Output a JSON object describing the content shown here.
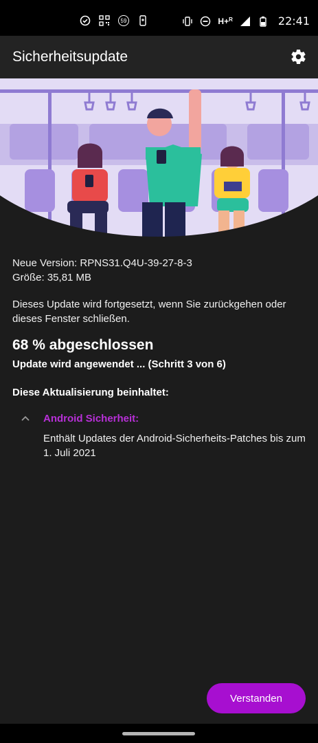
{
  "status_bar": {
    "time": "22:41",
    "notification_badge": "59",
    "network_label": "H+",
    "roaming_label": "R",
    "left_icons": [
      "check-circle-icon",
      "qr-code-icon",
      "badge-59-icon",
      "phone-transfer-icon"
    ],
    "right_icons": [
      "vibrate-icon",
      "do-not-disturb-icon",
      "signal-icon",
      "battery-icon"
    ]
  },
  "app_bar": {
    "title": "Sicherheitsupdate",
    "settings_icon": "gear-icon"
  },
  "update": {
    "version_line": "Neue Version: RPNS31.Q4U-39-27-8-3",
    "size_line": "Größe: 35,81 MB",
    "note": "Dieses Update wird fortgesetzt, wenn Sie zurückgehen oder dieses Fenster schließen.",
    "progress_text": "68 % abgeschlossen",
    "progress_percent": 68,
    "step_text": "Update wird angewendet ... (Schritt 3 von 6)"
  },
  "contents": {
    "heading": "Diese Aktualisierung beinhaltet:",
    "items": [
      {
        "title": "Android Sicherheit:",
        "description": "Enthält Updates der Android-Sicherheits-Patches bis zum 1. Juli 2021",
        "expanded": true
      }
    ]
  },
  "actions": {
    "confirm_label": "Verstanden"
  },
  "colors": {
    "accent": "#a70fd0",
    "section_title": "#b830d8",
    "background": "#1c1c1c",
    "app_bar": "#232323",
    "illustration_bg": "#e3dcf5"
  }
}
